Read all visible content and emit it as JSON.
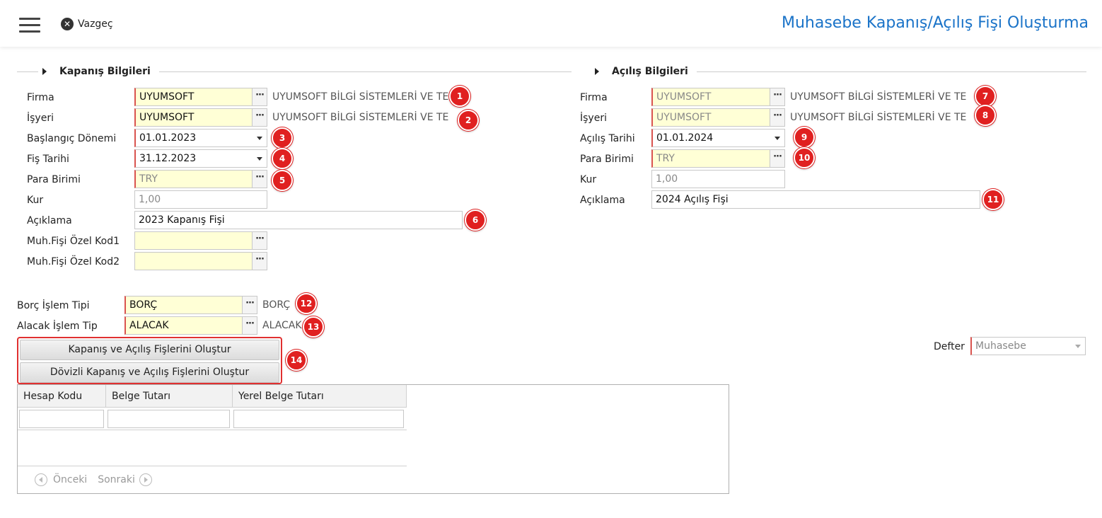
{
  "header": {
    "cancel_label": "Vazgeç",
    "title": "Muhasebe Kapanış/Açılış Fişi Oluşturma"
  },
  "closing": {
    "section_title": "Kapanış Bilgileri",
    "firma": {
      "label": "Firma",
      "value": "UYUMSOFT",
      "desc": "UYUMSOFT BİLGİ SİSTEMLERİ VE TE",
      "badge": "1"
    },
    "isyeri": {
      "label": "İşyeri",
      "value": "UYUMSOFT",
      "desc": "UYUMSOFT BİLGİ SİSTEMLERİ VE TE",
      "badge": "2"
    },
    "baslangic_donemi": {
      "label": "Başlangıç Dönemi",
      "value": "01.01.2023",
      "badge": "3"
    },
    "fis_tarihi": {
      "label": "Fiş Tarihi",
      "value": "31.12.2023",
      "badge": "4"
    },
    "para_birimi": {
      "label": "Para Birimi",
      "value": "TRY",
      "badge": "5"
    },
    "kur": {
      "label": "Kur",
      "value": "1,00"
    },
    "aciklama": {
      "label": "Açıklama",
      "value": "2023 Kapanış Fişi",
      "badge": "6"
    },
    "ozel_kod1": {
      "label": "Muh.Fişi Özel Kod1",
      "value": ""
    },
    "ozel_kod2": {
      "label": "Muh.Fişi Özel Kod2",
      "value": ""
    }
  },
  "opening": {
    "section_title": "Açılış Bilgileri",
    "firma": {
      "label": "Firma",
      "value": "UYUMSOFT",
      "desc": "UYUMSOFT BİLGİ SİSTEMLERİ VE TE",
      "badge": "7"
    },
    "isyeri": {
      "label": "İşyeri",
      "value": "UYUMSOFT",
      "desc": "UYUMSOFT BİLGİ SİSTEMLERİ VE TE",
      "badge": "8"
    },
    "acilis_tarihi": {
      "label": "Açılış Tarihi",
      "value": "01.01.2024",
      "badge": "9"
    },
    "para_birimi": {
      "label": "Para Birimi",
      "value": "TRY",
      "badge": "10"
    },
    "kur": {
      "label": "Kur",
      "value": "1,00"
    },
    "aciklama": {
      "label": "Açıklama",
      "value": "2024 Açılış Fişi",
      "badge": "11"
    }
  },
  "transaction": {
    "borc": {
      "label": "Borç İşlem Tipi",
      "value": "BORÇ",
      "desc": "BORÇ",
      "badge": "12"
    },
    "alacak": {
      "label": "Alacak İşlem Tip",
      "value": "ALACAK",
      "desc": "ALACAK",
      "badge": "13"
    }
  },
  "buttons": {
    "create": "Kapanış ve Açılış Fişlerini Oluştur",
    "create_fx": "Dövizli Kapanış ve Açılış Fişlerini Oluştur",
    "badge": "14"
  },
  "defter": {
    "label": "Defter",
    "value": "Muhasebe"
  },
  "grid": {
    "columns": [
      "Hesap Kodu",
      "Belge Tutarı",
      "Yerel Belge Tutarı"
    ],
    "pager_prev": "Önceki",
    "pager_next": "Sonraki"
  },
  "colors": {
    "accent": "#1a73c8",
    "badge": "#e02020",
    "required": "#d9534f",
    "field_yellow": "#ffffd6"
  },
  "icons": {
    "menu": "hamburger-icon",
    "cancel": "close-circle-icon",
    "lookup": "ellipsis-icon",
    "dropdown": "chevron-down-icon"
  }
}
